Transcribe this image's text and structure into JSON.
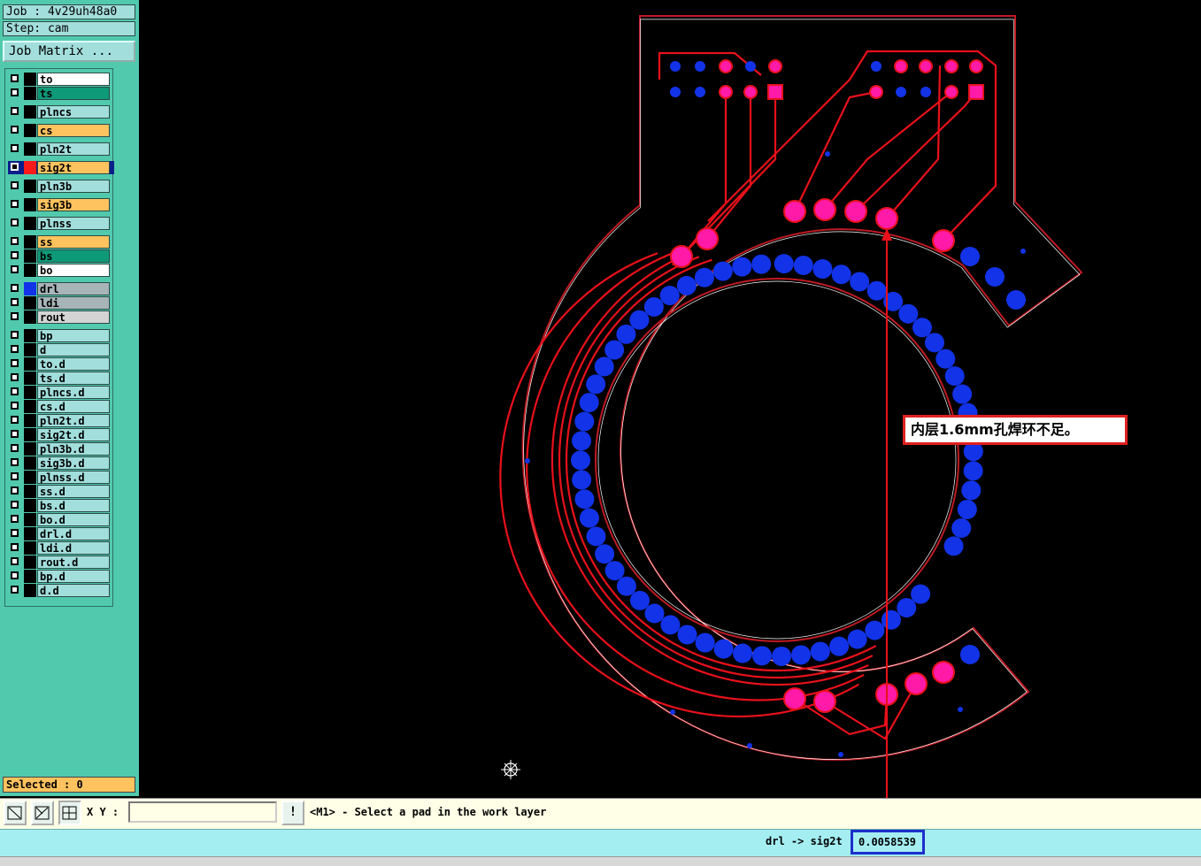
{
  "header": {
    "job": "Job : 4v29uh48a0",
    "step": "Step: cam",
    "job_matrix_button": "Job Matrix ..."
  },
  "layers": [
    {
      "name": "to",
      "color": "white"
    },
    {
      "name": "ts",
      "color": "green"
    },
    {
      "name": "plncs",
      "color": "cyan"
    },
    {
      "name": "cs",
      "color": "orange"
    },
    {
      "name": "pln2t",
      "color": "cyan"
    },
    {
      "name": "sig2t",
      "color": "orange",
      "swatch": "red",
      "work": true
    },
    {
      "name": "pln3b",
      "color": "cyan"
    },
    {
      "name": "sig3b",
      "color": "orange"
    },
    {
      "name": "plnss",
      "color": "cyan"
    },
    {
      "name": "ss",
      "color": "orange"
    },
    {
      "name": "bs",
      "color": "green"
    },
    {
      "name": "bo",
      "color": "white"
    },
    {
      "name": "drl",
      "color": "grey",
      "swatch": "blue"
    },
    {
      "name": "ldi",
      "color": "grey"
    },
    {
      "name": "rout",
      "color": "lgrey"
    },
    {
      "name": "bp",
      "color": "cyan"
    },
    {
      "name": "d",
      "color": "cyan"
    },
    {
      "name": "to.d",
      "color": "cyan"
    },
    {
      "name": "ts.d",
      "color": "cyan"
    },
    {
      "name": "plncs.d",
      "color": "cyan"
    },
    {
      "name": "cs.d",
      "color": "cyan"
    },
    {
      "name": "pln2t.d",
      "color": "cyan"
    },
    {
      "name": "sig2t.d",
      "color": "cyan"
    },
    {
      "name": "pln3b.d",
      "color": "cyan"
    },
    {
      "name": "sig3b.d",
      "color": "cyan"
    },
    {
      "name": "plnss.d",
      "color": "cyan"
    },
    {
      "name": "ss.d",
      "color": "cyan"
    },
    {
      "name": "bs.d",
      "color": "cyan"
    },
    {
      "name": "bo.d",
      "color": "cyan"
    },
    {
      "name": "drl.d",
      "color": "cyan"
    },
    {
      "name": "ldi.d",
      "color": "cyan"
    },
    {
      "name": "rout.d",
      "color": "cyan"
    },
    {
      "name": "bp.d",
      "color": "cyan"
    },
    {
      "name": "d.d",
      "color": "cyan"
    }
  ],
  "selected_label": "Selected : 0",
  "toolbar": {
    "xy_label": "X Y :",
    "xy_value": "",
    "warn_label": "!",
    "prompt": "<M1> - Select a pad in the work layer"
  },
  "status": {
    "relation": "drl -> sig2t :",
    "measure": "0.0058539"
  },
  "annotation": "内层1.6mm孔焊环不足。",
  "colors": {
    "panel_bg": "#51c9ad",
    "trace": "#e8111b",
    "drill": "#1233e8",
    "pad": "#ff1aa8",
    "annotation_border": "#e02020"
  }
}
